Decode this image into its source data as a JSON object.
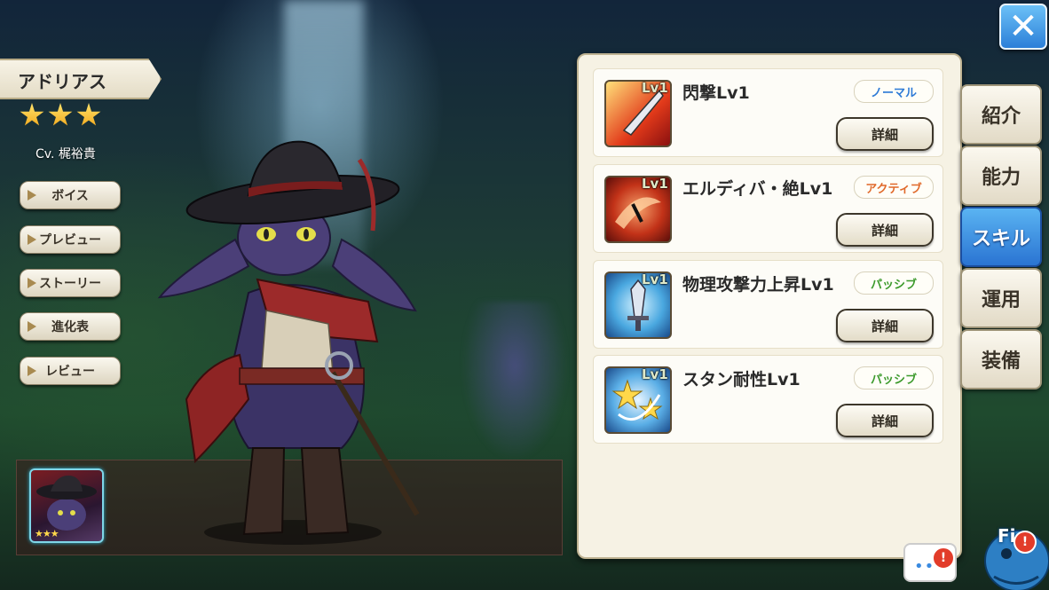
{
  "character": {
    "name": "アドリアス",
    "rarity_stars": 3,
    "cv": "Cv. 梶裕貴",
    "thumb_stars": "★★★"
  },
  "side_menu": [
    "ボイス",
    "プレビュー",
    "ストーリー",
    "進化表",
    "レビュー"
  ],
  "skills": [
    {
      "lv": "Lv1",
      "name": "閃撃Lv1",
      "type": "ノーマル",
      "type_color": "#2d7ad6",
      "detail": "詳細",
      "icon": "sword-slash-icon"
    },
    {
      "lv": "Lv1",
      "name": "エルディバ・絶Lv1",
      "type": "アクティブ",
      "type_color": "#e0692a",
      "detail": "詳細",
      "icon": "fire-strike-icon"
    },
    {
      "lv": "Lv1",
      "name": "物理攻撃力上昇Lv1",
      "type": "パッシブ",
      "type_color": "#3c9a2c",
      "detail": "詳細",
      "icon": "sword-up-icon"
    },
    {
      "lv": "Lv1",
      "name": "スタン耐性Lv1",
      "type": "パッシブ",
      "type_color": "#3c9a2c",
      "detail": "詳細",
      "icon": "stars-icon"
    }
  ],
  "tabs": [
    {
      "label": "紹介",
      "active": false
    },
    {
      "label": "能力",
      "active": false
    },
    {
      "label": "スキル",
      "active": true
    },
    {
      "label": "運用",
      "active": false
    },
    {
      "label": "装備",
      "active": false
    }
  ],
  "close_label": "✕",
  "chat_dots": "••",
  "alert_mark": "!",
  "field_label": "Fi"
}
